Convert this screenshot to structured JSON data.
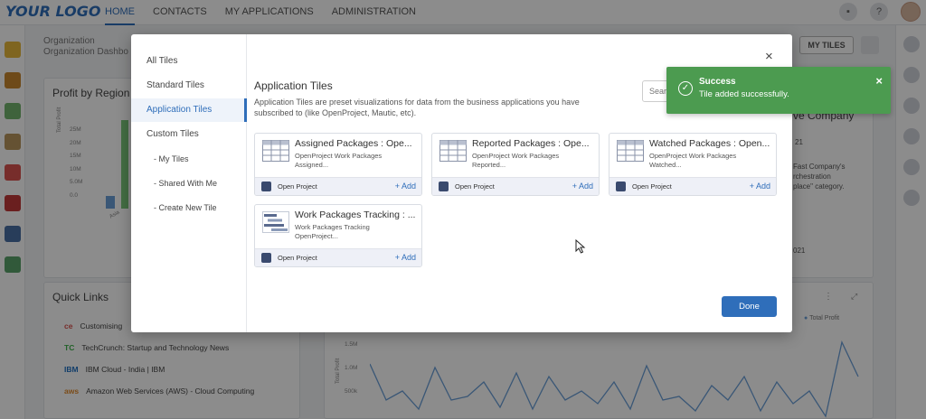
{
  "header": {
    "logo": "YOUR LOGO",
    "nav": [
      "HOME",
      "CONTACTS",
      "MY APPLICATIONS",
      "ADMINISTRATION"
    ],
    "help_icon": "?"
  },
  "breadcrumb": {
    "line1": "Organization",
    "line2": "Organization Dashbo"
  },
  "my_tiles_button": "MY TILES",
  "background": {
    "profit_title": "Profit by Region",
    "profit_yticks": [
      "25M",
      "20M",
      "15M",
      "10M",
      "5.0M",
      "0.0"
    ],
    "profit_ylabel": "Total Profit",
    "profit_xtick": "Asia",
    "quick_links_title": "Quick Links",
    "quick_links": [
      {
        "icon": "ce",
        "label": "Customising"
      },
      {
        "icon": "TC",
        "label": "TechCrunch: Startup and Technology News"
      },
      {
        "icon": "IBM",
        "label": "IBM Cloud - India | IBM"
      },
      {
        "icon": "aws",
        "label": "Amazon Web Services (AWS) - Cloud Computing"
      }
    ],
    "company_title": "ve Company",
    "company_texts": [
      "21",
      "Fast Company's",
      "rchestration",
      "place\" category.",
      "021"
    ],
    "profit_legend": "Total Profit",
    "line_yticks": [
      "1.5M",
      "1.0M",
      "500k"
    ],
    "line_ylabel": "Total Profit"
  },
  "modal": {
    "sidebar": [
      {
        "label": "All Tiles",
        "sub": false,
        "active": false
      },
      {
        "label": "Standard Tiles",
        "sub": false,
        "active": false
      },
      {
        "label": "Application Tiles",
        "sub": false,
        "active": true
      },
      {
        "label": "Custom Tiles",
        "sub": false,
        "active": false
      },
      {
        "label": "- My Tiles",
        "sub": true,
        "active": false
      },
      {
        "label": "- Shared With Me",
        "sub": true,
        "active": false
      },
      {
        "label": "- Create New Tile",
        "sub": true,
        "active": false
      }
    ],
    "title": "Application Tiles",
    "description": "Application Tiles are preset visualizations for data from the business applications you have subscribed to (like OpenProject, Mautic, etc).",
    "search_placeholder": "Search",
    "tiles": [
      {
        "name": "Assigned Packages : Ope...",
        "desc_line1": "OpenProject Work Packages",
        "desc_line2": "Assigned...",
        "app": "Open Project",
        "add": "+ Add",
        "icon": "table-icon"
      },
      {
        "name": "Reported Packages : Ope...",
        "desc_line1": "OpenProject Work Packages",
        "desc_line2": "Reported...",
        "app": "Open Project",
        "add": "+ Add",
        "icon": "table-icon"
      },
      {
        "name": "Watched Packages : Open...",
        "desc_line1": "OpenProject Work Packages",
        "desc_line2": "Watched...",
        "app": "Open Project",
        "add": "+ Add",
        "icon": "table-icon"
      },
      {
        "name": "Work Packages Tracking : ...",
        "desc_line1": "Work Packages Tracking",
        "desc_line2": "OpenProject...",
        "app": "Open Project",
        "add": "+ Add",
        "icon": "gantt-icon"
      }
    ],
    "done": "Done",
    "close": "×"
  },
  "toast": {
    "title": "Success",
    "message": "Tile added successfully.",
    "close": "×",
    "check": "✓",
    "color": "#4c9b50"
  },
  "colors": {
    "accent": "#2f6eba"
  }
}
